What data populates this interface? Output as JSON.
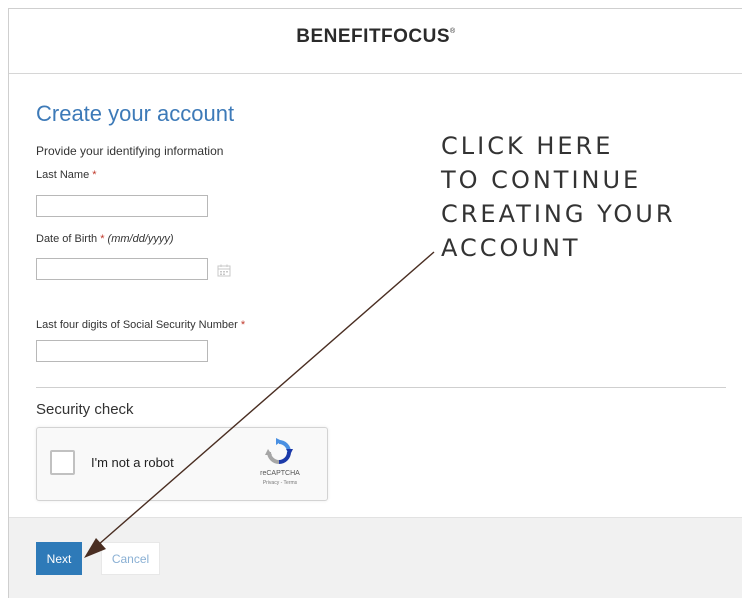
{
  "brand": {
    "logo_text": "BENEFITFOCUS",
    "logo_mark": "®"
  },
  "form": {
    "title": "Create your account",
    "subtitle": "Provide your identifying information",
    "fields": {
      "last_name": {
        "label": "Last Name",
        "required": "*",
        "value": ""
      },
      "dob": {
        "label": "Date of Birth",
        "required": "*",
        "hint": "(mm/dd/yyyy)",
        "value": ""
      },
      "ssn4": {
        "label": "Last four digits of Social Security Number",
        "required": "*",
        "value": ""
      }
    },
    "security": {
      "title": "Security check",
      "checkbox_label": "I'm not a robot",
      "recaptcha_text": "reCAPTCHA",
      "recaptcha_links": "Privacy - Terms"
    }
  },
  "footer": {
    "next_label": "Next",
    "cancel_label": "Cancel"
  },
  "annotation": {
    "lines": [
      "CLICK HERE",
      "TO CONTINUE",
      "CREATING YOUR",
      "ACCOUNT"
    ],
    "color": "#4a2e22"
  }
}
